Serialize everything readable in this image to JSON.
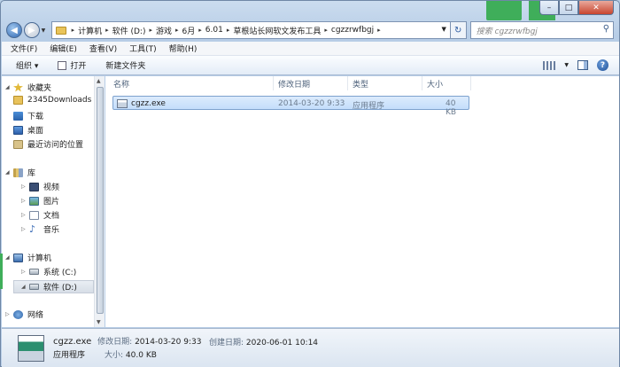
{
  "window": {
    "caption_buttons": {
      "minimize": "–",
      "maximize": "□",
      "close": "✕"
    }
  },
  "address": {
    "crumbs": [
      "计算机",
      "软件 (D:)",
      "游戏",
      "6月",
      "6.01",
      "草根站长网软文发布工具",
      "cgzzrwfbgj"
    ],
    "search_placeholder": "搜索 cgzzrwfbgj"
  },
  "menu": [
    "文件(F)",
    "编辑(E)",
    "查看(V)",
    "工具(T)",
    "帮助(H)"
  ],
  "toolbar": {
    "organize": "组织 ▾",
    "open": "打开",
    "new_folder": "新建文件夹"
  },
  "nav": {
    "favorites": "收藏夹",
    "fav_items": [
      "2345Downloads",
      "下载",
      "桌面",
      "最近访问的位置"
    ],
    "libraries": "库",
    "lib_items": [
      "视频",
      "图片",
      "文档",
      "音乐"
    ],
    "computer": "计算机",
    "drives": [
      "系统 (C:)",
      "软件 (D:)"
    ],
    "network": "网络"
  },
  "columns": {
    "name": "名称",
    "modified": "修改日期",
    "type": "类型",
    "size": "大小"
  },
  "files": [
    {
      "name": "cgzz.exe",
      "modified": "2014-03-20 9:33",
      "type": "应用程序",
      "size": "40 KB"
    }
  ],
  "details": {
    "filename": "cgzz.exe",
    "modified_label": "修改日期:",
    "modified": "2014-03-20 9:33",
    "created_label": "创建日期:",
    "created": "2020-06-01 10:14",
    "type": "应用程序",
    "size_label": "大小:",
    "size": "40.0 KB"
  },
  "colors": {
    "accent_green": "#3fae5a",
    "selection": "#c4defb"
  }
}
